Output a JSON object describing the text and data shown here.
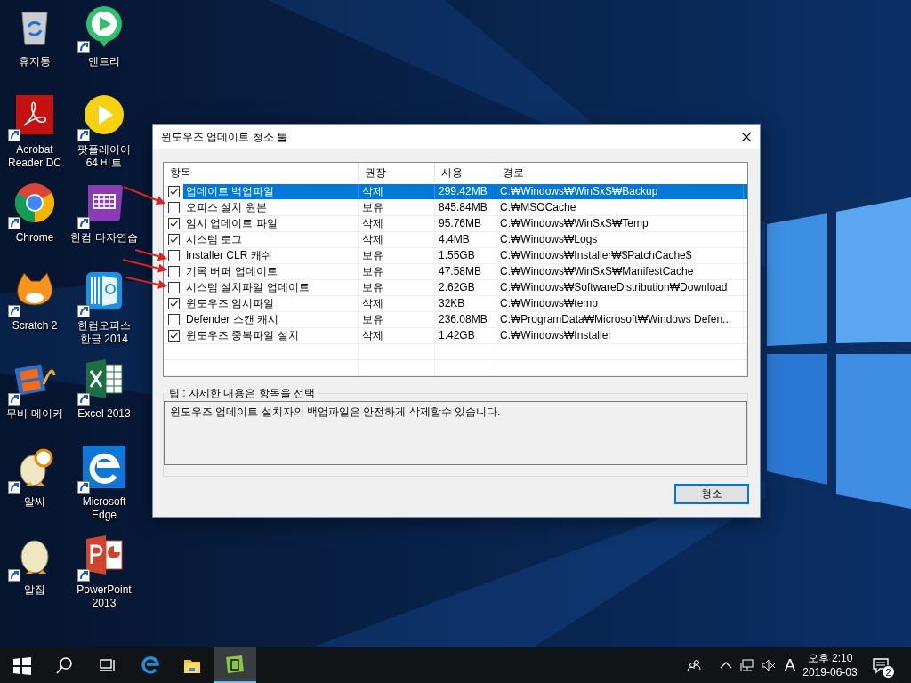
{
  "desktop": {
    "icons": [
      {
        "kind": "recycle",
        "label": "휴지통",
        "shortcut": false
      },
      {
        "kind": "acrobat",
        "label": "Acrobat Reader DC",
        "shortcut": true
      },
      {
        "kind": "chrome",
        "label": "Chrome",
        "shortcut": true
      },
      {
        "kind": "cat",
        "label": "Scratch 2",
        "shortcut": true
      },
      {
        "kind": "film",
        "label": "무비 메이커",
        "shortcut": true
      },
      {
        "kind": "egglens",
        "label": "알씨",
        "shortcut": true
      },
      {
        "kind": "egg",
        "label": "알집",
        "shortcut": true
      },
      {
        "kind": "playpin",
        "label": "엔트리",
        "shortcut": true
      },
      {
        "kind": "play",
        "label": "팟플레이어 64 비트",
        "shortcut": true
      },
      {
        "kind": "keyboard",
        "label": "한컴 타자연습",
        "shortcut": true
      },
      {
        "kind": "hangul",
        "label": "한컴오피스 한글 2014",
        "shortcut": true
      },
      {
        "kind": "excel",
        "label": "Excel 2013",
        "shortcut": true
      },
      {
        "kind": "edge",
        "label": "Microsoft Edge",
        "shortcut": true
      },
      {
        "kind": "powerpoint",
        "label": "PowerPoint 2013",
        "shortcut": true
      }
    ]
  },
  "dialog": {
    "title": "윈도우즈 업데이트 청소 툴",
    "columns": [
      "항목",
      "권장",
      "사용",
      "경로"
    ],
    "rows": [
      {
        "checked": true,
        "selected": true,
        "item": "업데이트 백업파일",
        "recommend": "삭제",
        "size": "299.42MB",
        "path": "C:₩Windows₩WinSxS₩Backup"
      },
      {
        "checked": false,
        "selected": false,
        "item": "오피스 설치 원본",
        "recommend": "보유",
        "size": "845.84MB",
        "path": "C:₩MSOCache"
      },
      {
        "checked": true,
        "selected": false,
        "item": "임시 업데이트 파일",
        "recommend": "삭제",
        "size": "95.76MB",
        "path": "C:₩Windows₩WinSxS₩Temp"
      },
      {
        "checked": true,
        "selected": false,
        "item": "시스템 로그",
        "recommend": "삭제",
        "size": "4.4MB",
        "path": "C:₩Windows₩Logs"
      },
      {
        "checked": false,
        "selected": false,
        "item": "Installer CLR 캐쉬",
        "recommend": "보유",
        "size": "1.55GB",
        "path": "C:₩Windows₩Installer₩$PatchCache$"
      },
      {
        "checked": false,
        "selected": false,
        "item": "기록 버퍼 업데이트",
        "recommend": "보유",
        "size": "47.58MB",
        "path": "C:₩Windows₩WinSxS₩ManifestCache"
      },
      {
        "checked": false,
        "selected": false,
        "item": "시스템 설치파일 업데이트",
        "recommend": "보유",
        "size": "2.62GB",
        "path": "C:₩Windows₩SoftwareDistribution₩Download"
      },
      {
        "checked": true,
        "selected": false,
        "item": "윈도우즈 임시파일",
        "recommend": "삭제",
        "size": "32KB",
        "path": "C:₩Windows₩temp"
      },
      {
        "checked": false,
        "selected": false,
        "item": "Defender 스캔 캐시",
        "recommend": "보유",
        "size": "236.08MB",
        "path": "C:₩ProgramData₩Microsoft₩Windows Defen..."
      },
      {
        "checked": true,
        "selected": false,
        "item": "윈도우즈 중복파일 설치",
        "recommend": "삭제",
        "size": "1.42GB",
        "path": "C:₩Windows₩Installer"
      }
    ],
    "tip_label": "팁 : 자세한 내용은 항목을 선택",
    "tip_text": "윈도우즈 업데이트 설치자의 백업파일은 안전하게 삭제할수 있습니다.",
    "button": "청소"
  },
  "taskbar": {
    "apps": [
      {
        "kind": "start",
        "active": false
      },
      {
        "kind": "search",
        "active": false
      },
      {
        "kind": "taskview",
        "active": false
      },
      {
        "kind": "edge",
        "active": false
      },
      {
        "kind": "folder",
        "active": false
      },
      {
        "kind": "trashapp",
        "active": true
      }
    ],
    "tray": [
      {
        "kind": "people"
      },
      {
        "kind": "chevron"
      },
      {
        "kind": "network"
      },
      {
        "kind": "mute"
      }
    ],
    "input_mode": "A",
    "time": "오후 2:10",
    "date": "2019-06-03",
    "notifications": "2"
  }
}
